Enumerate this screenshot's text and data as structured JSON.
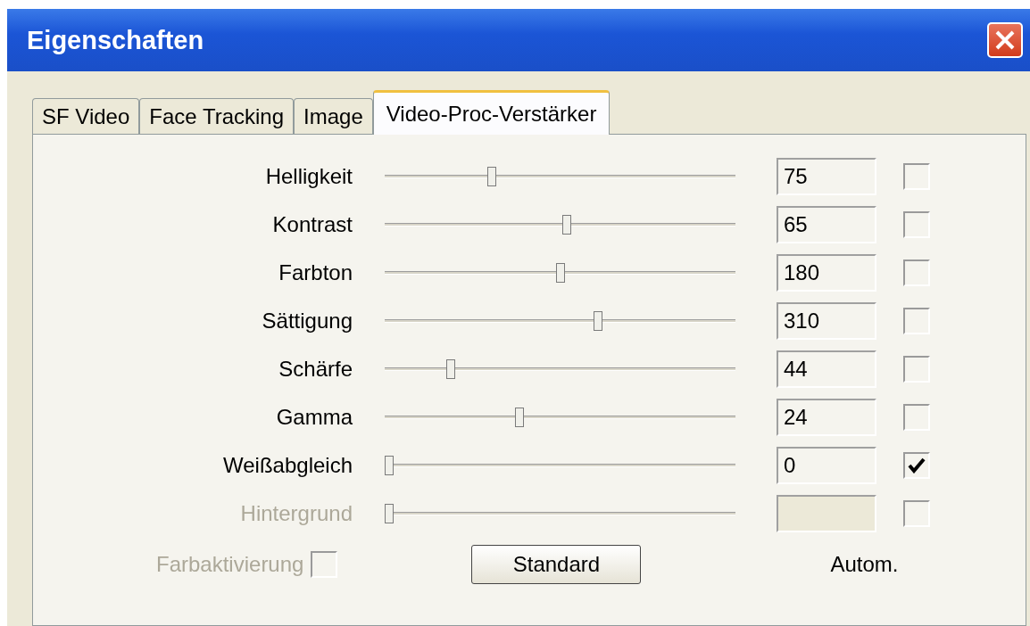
{
  "window": {
    "title": "Eigenschaften"
  },
  "tabs": [
    {
      "label": "SF Video",
      "selected": false
    },
    {
      "label": "Face Tracking",
      "selected": false
    },
    {
      "label": "Image",
      "selected": false
    },
    {
      "label": "Video-Proc-Verstärker",
      "selected": true
    }
  ],
  "rows": [
    {
      "label": "Helligkeit",
      "level": 0.3,
      "value": "75",
      "auto": false,
      "disabled": false
    },
    {
      "label": "Kontrast",
      "level": 0.52,
      "value": "65",
      "auto": false,
      "disabled": false
    },
    {
      "label": "Farbton",
      "level": 0.5,
      "value": "180",
      "auto": false,
      "disabled": false
    },
    {
      "label": "Sättigung",
      "level": 0.61,
      "value": "310",
      "auto": false,
      "disabled": false
    },
    {
      "label": "Schärfe",
      "level": 0.18,
      "value": "44",
      "auto": false,
      "disabled": false
    },
    {
      "label": "Gamma",
      "level": 0.38,
      "value": "24",
      "auto": false,
      "disabled": false
    },
    {
      "label": "Weißabgleich",
      "level": 0,
      "value": "0",
      "auto": true,
      "disabled": false
    },
    {
      "label": "Hintergrund",
      "level": 0,
      "auto": false,
      "disabled": true
    }
  ],
  "color_enable": {
    "label": "Farbaktivierung",
    "checked": false,
    "disabled": true
  },
  "default_button": "Standard",
  "auto_label": "Autom."
}
